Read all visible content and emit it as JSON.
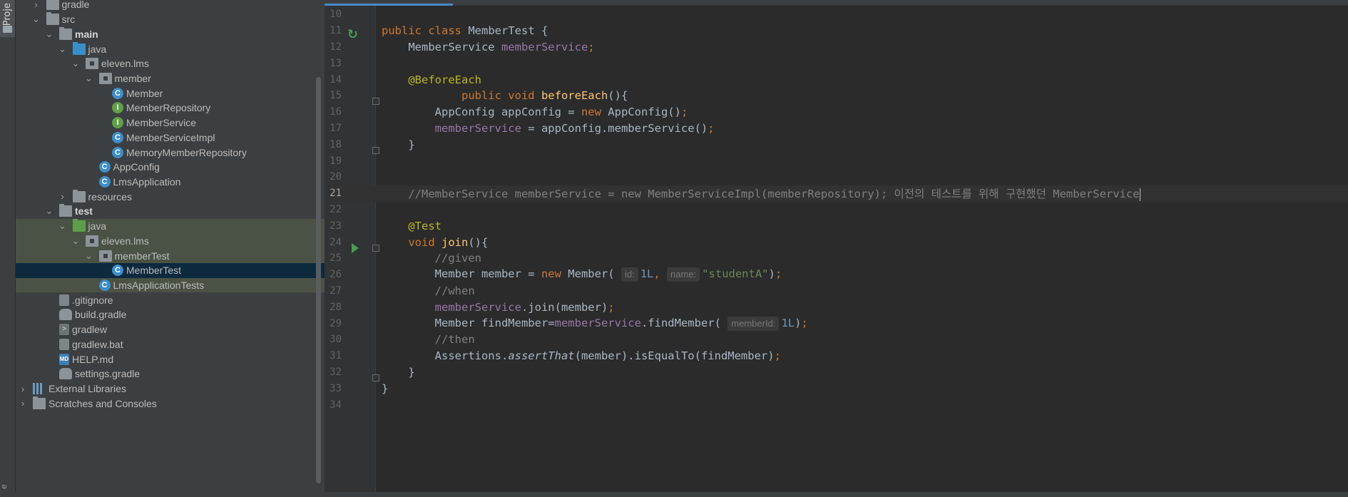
{
  "app": {
    "project_tab_label": "Proje",
    "bottom_strip_label": "e"
  },
  "project_tree": [
    {
      "label": "gradle",
      "icon": "folder-grey-icon",
      "arrow": "right",
      "indent": 1,
      "state": ""
    },
    {
      "label": "src",
      "icon": "folder-grey-icon",
      "arrow": "down",
      "indent": 1,
      "state": ""
    },
    {
      "label": "main",
      "icon": "folder-grey-icon",
      "arrow": "down",
      "indent": 2,
      "state": "",
      "bold": true
    },
    {
      "label": "java",
      "icon": "folder-blue-icon",
      "arrow": "down",
      "indent": 3,
      "state": ""
    },
    {
      "label": "eleven.lms",
      "icon": "package-icon",
      "arrow": "down",
      "indent": 4,
      "state": ""
    },
    {
      "label": "member",
      "icon": "package-icon",
      "arrow": "down",
      "indent": 5,
      "state": ""
    },
    {
      "label": "Member",
      "icon": "class-icon",
      "arrow": "none",
      "indent": 6,
      "state": ""
    },
    {
      "label": "MemberRepository",
      "icon": "interface-icon",
      "arrow": "none",
      "indent": 6,
      "state": ""
    },
    {
      "label": "MemberService",
      "icon": "interface-icon",
      "arrow": "none",
      "indent": 6,
      "state": ""
    },
    {
      "label": "MemberServiceImpl",
      "icon": "class-icon",
      "arrow": "none",
      "indent": 6,
      "state": ""
    },
    {
      "label": "MemoryMemberRepository",
      "icon": "class-icon",
      "arrow": "none",
      "indent": 6,
      "state": ""
    },
    {
      "label": "AppConfig",
      "icon": "class-icon",
      "arrow": "none",
      "indent": 5,
      "state": ""
    },
    {
      "label": "LmsApplication",
      "icon": "class-icon",
      "arrow": "none",
      "indent": 5,
      "state": ""
    },
    {
      "label": "resources",
      "icon": "folder-grey-icon",
      "arrow": "right",
      "indent": 3,
      "state": ""
    },
    {
      "label": "test",
      "icon": "folder-grey-icon",
      "arrow": "down",
      "indent": 2,
      "state": "",
      "bold": true
    },
    {
      "label": "java",
      "icon": "folder-green-icon",
      "arrow": "down",
      "indent": 3,
      "state": "hl"
    },
    {
      "label": "eleven.lms",
      "icon": "package-icon",
      "arrow": "down",
      "indent": 4,
      "state": "hl"
    },
    {
      "label": "memberTest",
      "icon": "package-icon",
      "arrow": "down",
      "indent": 5,
      "state": "hl"
    },
    {
      "label": "MemberTest",
      "icon": "class-icon",
      "arrow": "none",
      "indent": 6,
      "state": "sel"
    },
    {
      "label": "LmsApplicationTests",
      "icon": "class-icon",
      "arrow": "none",
      "indent": 5,
      "state": "hl"
    },
    {
      "label": ".gitignore",
      "icon": "file-icon",
      "arrow": "none",
      "indent": 2,
      "state": ""
    },
    {
      "label": "build.gradle",
      "icon": "gradle-icon",
      "arrow": "none",
      "indent": 2,
      "state": ""
    },
    {
      "label": "gradlew",
      "icon": "terminal-icon",
      "arrow": "none",
      "indent": 2,
      "state": ""
    },
    {
      "label": "gradlew.bat",
      "icon": "file-icon",
      "arrow": "none",
      "indent": 2,
      "state": ""
    },
    {
      "label": "HELP.md",
      "icon": "markdown-icon",
      "arrow": "none",
      "indent": 2,
      "state": ""
    },
    {
      "label": "settings.gradle",
      "icon": "gradle-icon",
      "arrow": "none",
      "indent": 2,
      "state": ""
    },
    {
      "label": "External Libraries",
      "icon": "library-icon",
      "arrow": "right",
      "indent": 0,
      "state": ""
    },
    {
      "label": "Scratches and Consoles",
      "icon": "scratches-icon",
      "arrow": "right",
      "indent": 0,
      "state": ""
    }
  ],
  "editor": {
    "warnings_count": "1",
    "current_line": 21,
    "lines": [
      {
        "n": "10",
        "tokens": []
      },
      {
        "n": "11",
        "gutter": "rerun",
        "tokens": [
          [
            "kw",
            "public class "
          ],
          [
            "",
            "MemberTest {"
          ]
        ]
      },
      {
        "n": "12",
        "tokens": [
          [
            "",
            "    MemberService "
          ],
          [
            "fld",
            "memberService"
          ],
          [
            "kw",
            ";"
          ]
        ]
      },
      {
        "n": "13",
        "tokens": []
      },
      {
        "n": "14",
        "tokens": [
          [
            "ann",
            "    @BeforeEach"
          ]
        ]
      },
      {
        "n": "15",
        "fold": true,
        "tokens": [
          [
            "kw",
            "            public void "
          ],
          [
            "fn",
            "beforeEach"
          ],
          [
            "",
            "(){"
          ]
        ]
      },
      {
        "n": "16",
        "tokens": [
          [
            "",
            "        AppConfig appConfig = "
          ],
          [
            "kw",
            "new "
          ],
          [
            "",
            "AppConfig()"
          ],
          [
            "kw",
            ";"
          ]
        ]
      },
      {
        "n": "17",
        "tokens": [
          [
            "fld",
            "        memberService"
          ],
          [
            "",
            " = appConfig.memberService()"
          ],
          [
            "kw",
            ";"
          ]
        ]
      },
      {
        "n": "18",
        "fold": true,
        "tokens": [
          [
            "",
            "    }"
          ]
        ]
      },
      {
        "n": "19",
        "tokens": []
      },
      {
        "n": "20",
        "tokens": []
      },
      {
        "n": "21",
        "caret": true,
        "tokens": [
          [
            "cmt",
            "    //MemberService memberService = new MemberServiceImpl(memberRepository); 이전의 테스트를 위해 구현했던 MemberService"
          ]
        ]
      },
      {
        "n": "22",
        "tokens": []
      },
      {
        "n": "23",
        "tokens": [
          [
            "ann",
            "    @Test"
          ]
        ]
      },
      {
        "n": "24",
        "gutter": "run",
        "fold": true,
        "tokens": [
          [
            "kw",
            "    void "
          ],
          [
            "fn",
            "join"
          ],
          [
            "",
            "(){"
          ]
        ]
      },
      {
        "n": "25",
        "tokens": [
          [
            "cmt",
            "        //given"
          ]
        ]
      },
      {
        "n": "26",
        "tokens": [
          [
            "",
            "        Member member = "
          ],
          [
            "kw",
            "new "
          ],
          [
            "",
            "Member( "
          ],
          [
            "hint",
            "id:"
          ],
          [
            "num",
            "1L"
          ],
          [
            "kw",
            ", "
          ],
          [
            "hint",
            "name:"
          ],
          [
            "str",
            "\"studentA\""
          ],
          [
            "",
            ")"
          ],
          [
            "kw",
            ";"
          ]
        ]
      },
      {
        "n": "27",
        "tokens": [
          [
            "cmt",
            "        //when"
          ]
        ]
      },
      {
        "n": "28",
        "tokens": [
          [
            "fld",
            "        memberService"
          ],
          [
            "",
            ".join(member)"
          ],
          [
            "kw",
            ";"
          ]
        ]
      },
      {
        "n": "29",
        "tokens": [
          [
            "",
            "        Member findMember="
          ],
          [
            "fld",
            "memberService"
          ],
          [
            "",
            ".findMember( "
          ],
          [
            "hint",
            "memberId:"
          ],
          [
            "num",
            "1L"
          ],
          [
            "",
            ")"
          ],
          [
            "kw",
            ";"
          ]
        ]
      },
      {
        "n": "30",
        "tokens": [
          [
            "cmt",
            "        //then"
          ]
        ]
      },
      {
        "n": "31",
        "tokens": [
          [
            "",
            "        Assertions."
          ],
          [
            "ital",
            "assertThat"
          ],
          [
            "",
            "(member).isEqualTo(findMember)"
          ],
          [
            "kw",
            ";"
          ]
        ]
      },
      {
        "n": "32",
        "fold": true,
        "tokens": [
          [
            "",
            "    }"
          ]
        ]
      },
      {
        "n": "33",
        "tokens": [
          [
            "",
            "}"
          ]
        ]
      },
      {
        "n": "34",
        "tokens": []
      }
    ]
  }
}
